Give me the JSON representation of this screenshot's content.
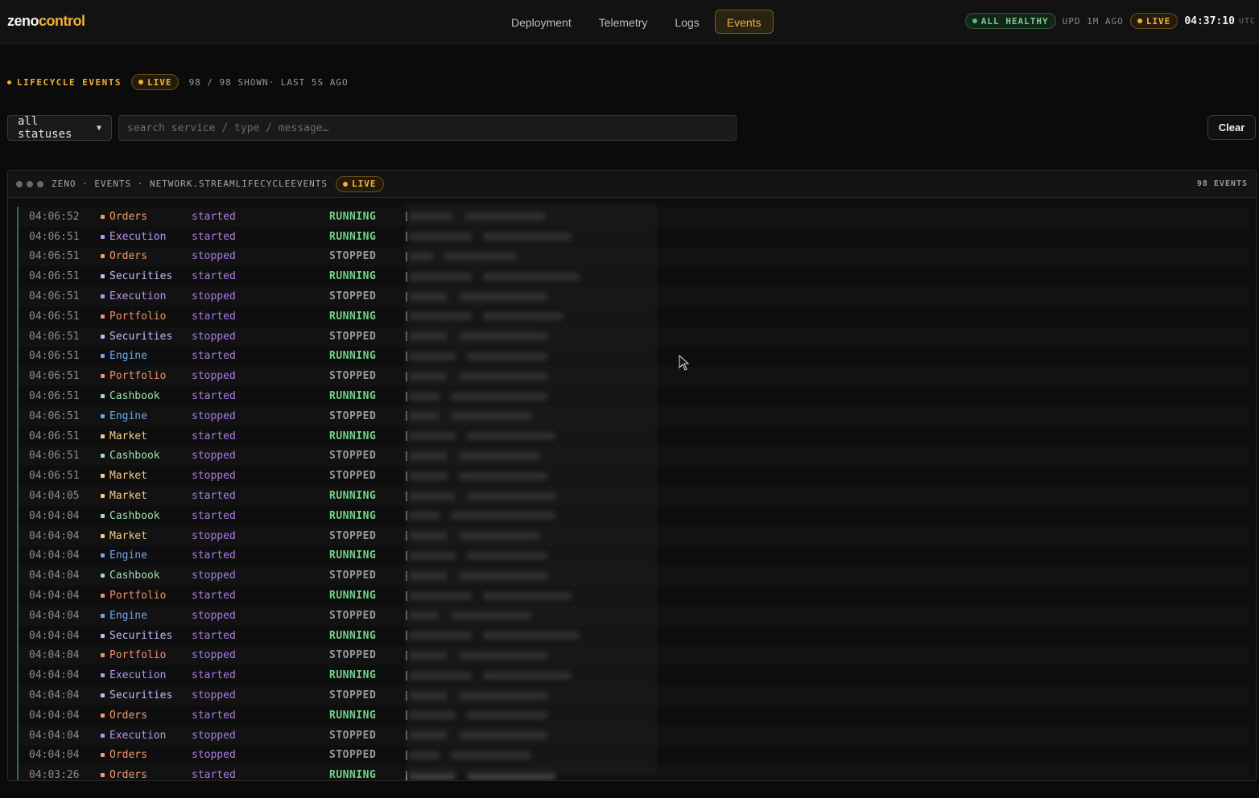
{
  "app": {
    "logo_a": "zeno",
    "logo_b": "control"
  },
  "nav": {
    "tabs": [
      {
        "label": "Deployment",
        "active": false
      },
      {
        "label": "Telemetry",
        "active": false
      },
      {
        "label": "Logs",
        "active": false
      },
      {
        "label": "Events",
        "active": true
      }
    ]
  },
  "status": {
    "health_label": "ALL HEALTHY",
    "updated": "UPD 1M AGO",
    "live_label": "LIVE",
    "clock": "04:37:10",
    "clock_tz": "UTC"
  },
  "section": {
    "title": "LIFECYCLE EVENTS",
    "live_label": "LIVE",
    "count_text": "98 / 98 SHOWN· LAST 5S AGO"
  },
  "filters": {
    "status_select_value": "all statuses",
    "search_placeholder": "search service / type / message…",
    "clear_label": "Clear"
  },
  "panel": {
    "path": "ZENO · EVENTS · NETWORK.STREAMLIFECYCLEEVENTS",
    "live_label": "LIVE",
    "count": "98 EVENTS"
  },
  "colors": {
    "accent": "#f0b234",
    "running": "#6fd38a",
    "type": "#a87ee0",
    "service": {
      "Orders": "#f59a6a",
      "Execution": "#b894f0",
      "Securities": "#c9b6f5",
      "Portfolio": "#f0906a",
      "Engine": "#6ea8f0",
      "Cashbook": "#9fe0b0",
      "Market": "#f5c98a"
    }
  },
  "events": [
    {
      "time": "04:06:52",
      "service": "Orders",
      "type": "started",
      "status": "RUNNING"
    },
    {
      "time": "04:06:51",
      "service": "Execution",
      "type": "started",
      "status": "RUNNING"
    },
    {
      "time": "04:06:51",
      "service": "Orders",
      "type": "stopped",
      "status": "STOPPED"
    },
    {
      "time": "04:06:51",
      "service": "Securities",
      "type": "started",
      "status": "RUNNING"
    },
    {
      "time": "04:06:51",
      "service": "Execution",
      "type": "stopped",
      "status": "STOPPED"
    },
    {
      "time": "04:06:51",
      "service": "Portfolio",
      "type": "started",
      "status": "RUNNING"
    },
    {
      "time": "04:06:51",
      "service": "Securities",
      "type": "stopped",
      "status": "STOPPED"
    },
    {
      "time": "04:06:51",
      "service": "Engine",
      "type": "started",
      "status": "RUNNING"
    },
    {
      "time": "04:06:51",
      "service": "Portfolio",
      "type": "stopped",
      "status": "STOPPED"
    },
    {
      "time": "04:06:51",
      "service": "Cashbook",
      "type": "started",
      "status": "RUNNING"
    },
    {
      "time": "04:06:51",
      "service": "Engine",
      "type": "stopped",
      "status": "STOPPED"
    },
    {
      "time": "04:06:51",
      "service": "Market",
      "type": "started",
      "status": "RUNNING"
    },
    {
      "time": "04:06:51",
      "service": "Cashbook",
      "type": "stopped",
      "status": "STOPPED"
    },
    {
      "time": "04:06:51",
      "service": "Market",
      "type": "stopped",
      "status": "STOPPED"
    },
    {
      "time": "04:04:05",
      "service": "Market",
      "type": "started",
      "status": "RUNNING"
    },
    {
      "time": "04:04:04",
      "service": "Cashbook",
      "type": "started",
      "status": "RUNNING"
    },
    {
      "time": "04:04:04",
      "service": "Market",
      "type": "stopped",
      "status": "STOPPED"
    },
    {
      "time": "04:04:04",
      "service": "Engine",
      "type": "started",
      "status": "RUNNING"
    },
    {
      "time": "04:04:04",
      "service": "Cashbook",
      "type": "stopped",
      "status": "STOPPED"
    },
    {
      "time": "04:04:04",
      "service": "Portfolio",
      "type": "started",
      "status": "RUNNING"
    },
    {
      "time": "04:04:04",
      "service": "Engine",
      "type": "stopped",
      "status": "STOPPED"
    },
    {
      "time": "04:04:04",
      "service": "Securities",
      "type": "started",
      "status": "RUNNING"
    },
    {
      "time": "04:04:04",
      "service": "Portfolio",
      "type": "stopped",
      "status": "STOPPED"
    },
    {
      "time": "04:04:04",
      "service": "Execution",
      "type": "started",
      "status": "RUNNING"
    },
    {
      "time": "04:04:04",
      "service": "Securities",
      "type": "stopped",
      "status": "STOPPED"
    },
    {
      "time": "04:04:04",
      "service": "Orders",
      "type": "started",
      "status": "RUNNING"
    },
    {
      "time": "04:04:04",
      "service": "Execution",
      "type": "stopped",
      "status": "STOPPED"
    },
    {
      "time": "04:04:04",
      "service": "Orders",
      "type": "stopped",
      "status": "STOPPED"
    },
    {
      "time": "04:03:26",
      "service": "Orders",
      "type": "started",
      "status": "RUNNING"
    }
  ]
}
